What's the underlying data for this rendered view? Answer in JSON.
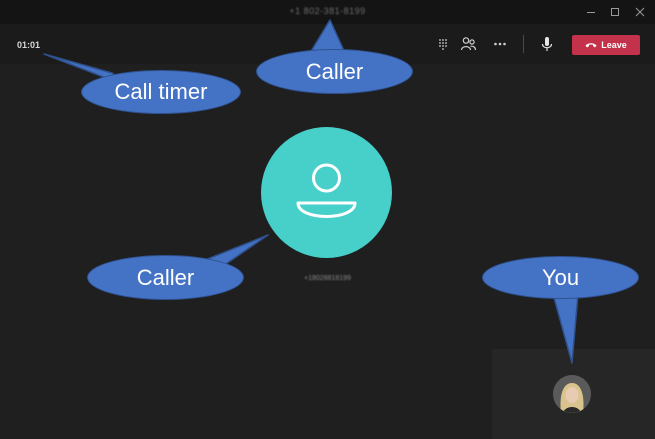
{
  "window": {
    "title": "+1 802-381-8199",
    "controls": {
      "minimize_icon": "minimize-icon",
      "maximize_icon": "maximize-icon",
      "close_icon": "close-icon"
    }
  },
  "toolbar": {
    "timer": "01:01",
    "buttons": [
      {
        "name": "dialpad",
        "icon": "dialpad-icon"
      },
      {
        "name": "participants",
        "icon": "people-icon"
      },
      {
        "name": "more",
        "icon": "more-icon"
      },
      {
        "name": "mute",
        "icon": "microphone-icon"
      }
    ],
    "leave_label": "Leave",
    "leave_icon": "phone-hangup-icon"
  },
  "call": {
    "caller_number": "+18028818199",
    "caller_avatar_icon": "person-icon"
  },
  "self_view": {
    "avatar_icon": "user-photo-avatar"
  },
  "annotations": {
    "call_timer": "Call timer",
    "caller_top": "Caller",
    "caller_mid": "Caller",
    "you": "You"
  },
  "colors": {
    "background": "#1f1f1f",
    "titlebar": "#141414",
    "toolbar": "#1b1b1b",
    "leave_red": "#c4314b",
    "avatar_teal": "#47cfca",
    "callout_blue": "#4472c4"
  }
}
